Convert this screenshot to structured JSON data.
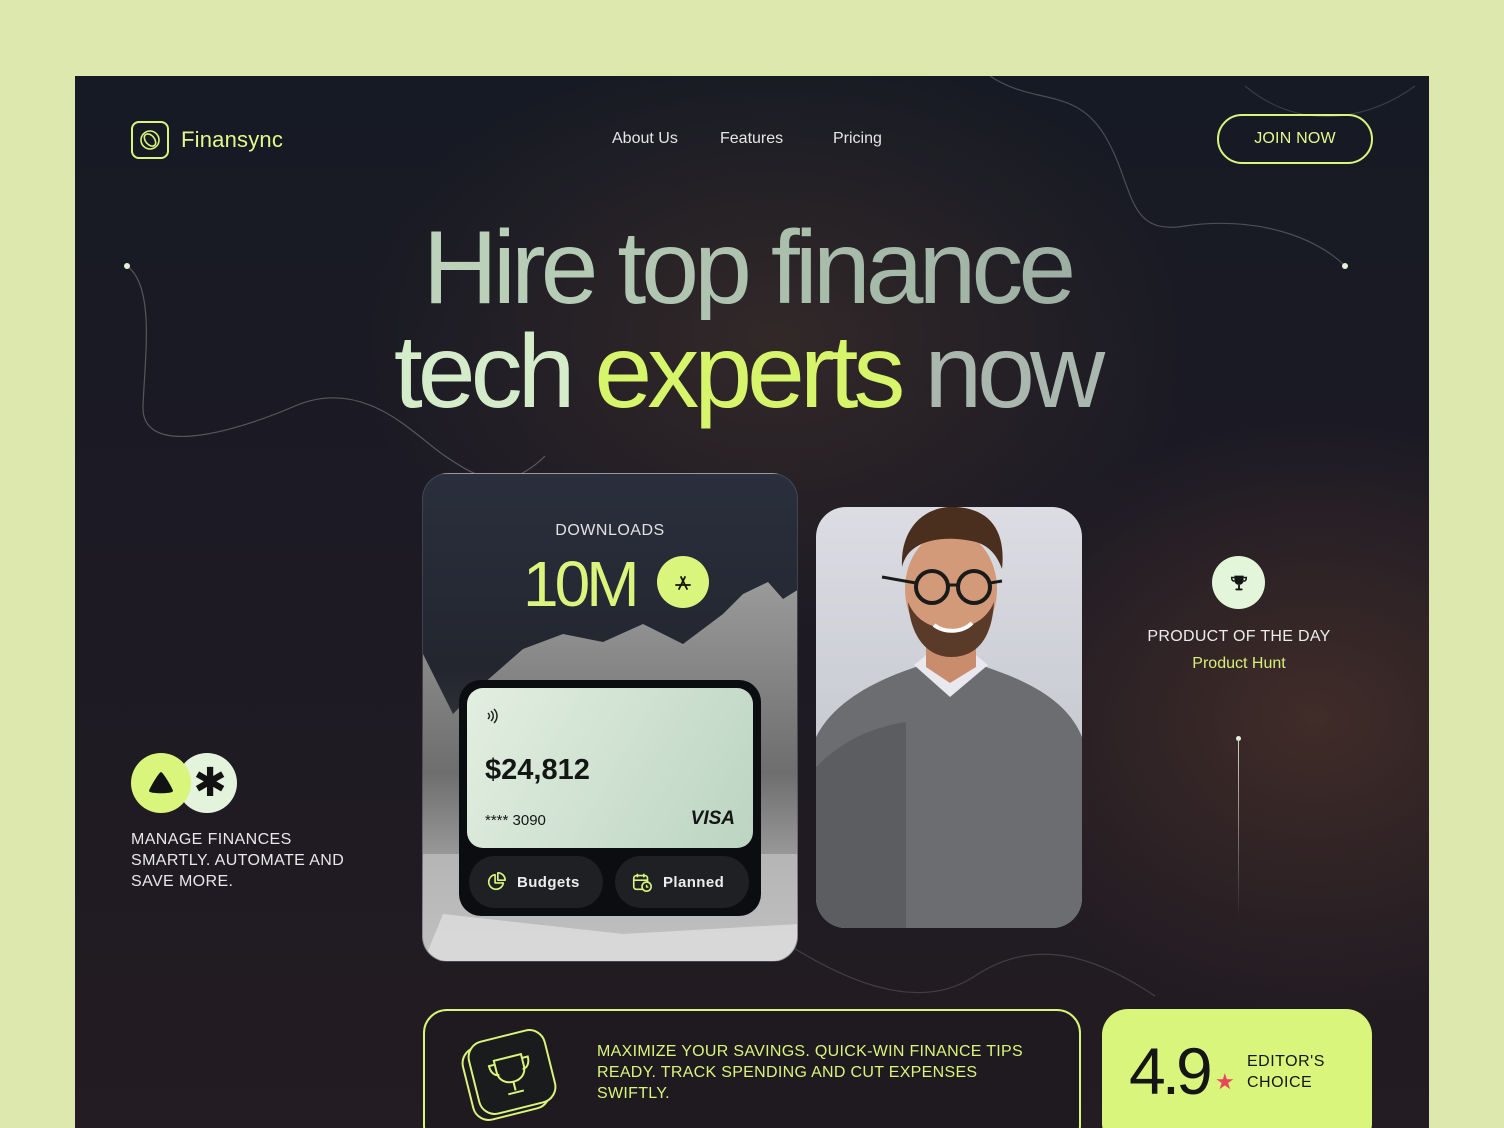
{
  "brand": {
    "name": "Finansync",
    "icon": "logo-mark-icon"
  },
  "nav": {
    "items": [
      "About Us",
      "Features",
      "Pricing"
    ],
    "cta": "JOIN NOW"
  },
  "hero": {
    "line1": "Hire top finance",
    "line2_part1": "tech",
    "line2_part2": "experts",
    "line2_part3": "now"
  },
  "downloads": {
    "label": "DOWNLOADS",
    "value": "10M",
    "icon": "app-store-icon"
  },
  "card": {
    "amount": "$24,812",
    "masked_number": "**** 3090",
    "network": "VISA",
    "actions": [
      {
        "label": "Budgets",
        "icon": "pie-chart-icon"
      },
      {
        "label": "Planned",
        "icon": "calendar-clock-icon"
      }
    ]
  },
  "award": {
    "title": "PRODUCT OF THE DAY",
    "source": "Product Hunt",
    "icon": "trophy-icon"
  },
  "manage": {
    "text": "MANAGE FINANCES SMARTLY. AUTOMATE AND SAVE MORE."
  },
  "tip": {
    "text": "MAXIMIZE YOUR SAVINGS. QUICK-WIN FINANCE TIPS READY. TRACK SPENDING AND CUT EXPENSES SWIFTLY."
  },
  "rating": {
    "value": "4.9",
    "star": "★",
    "label": "EDITOR'S CHOICE"
  },
  "colors": {
    "accent": "#d9f57c",
    "background": "#dce8ae",
    "panel": "#181a24",
    "star": "#e8465a"
  }
}
